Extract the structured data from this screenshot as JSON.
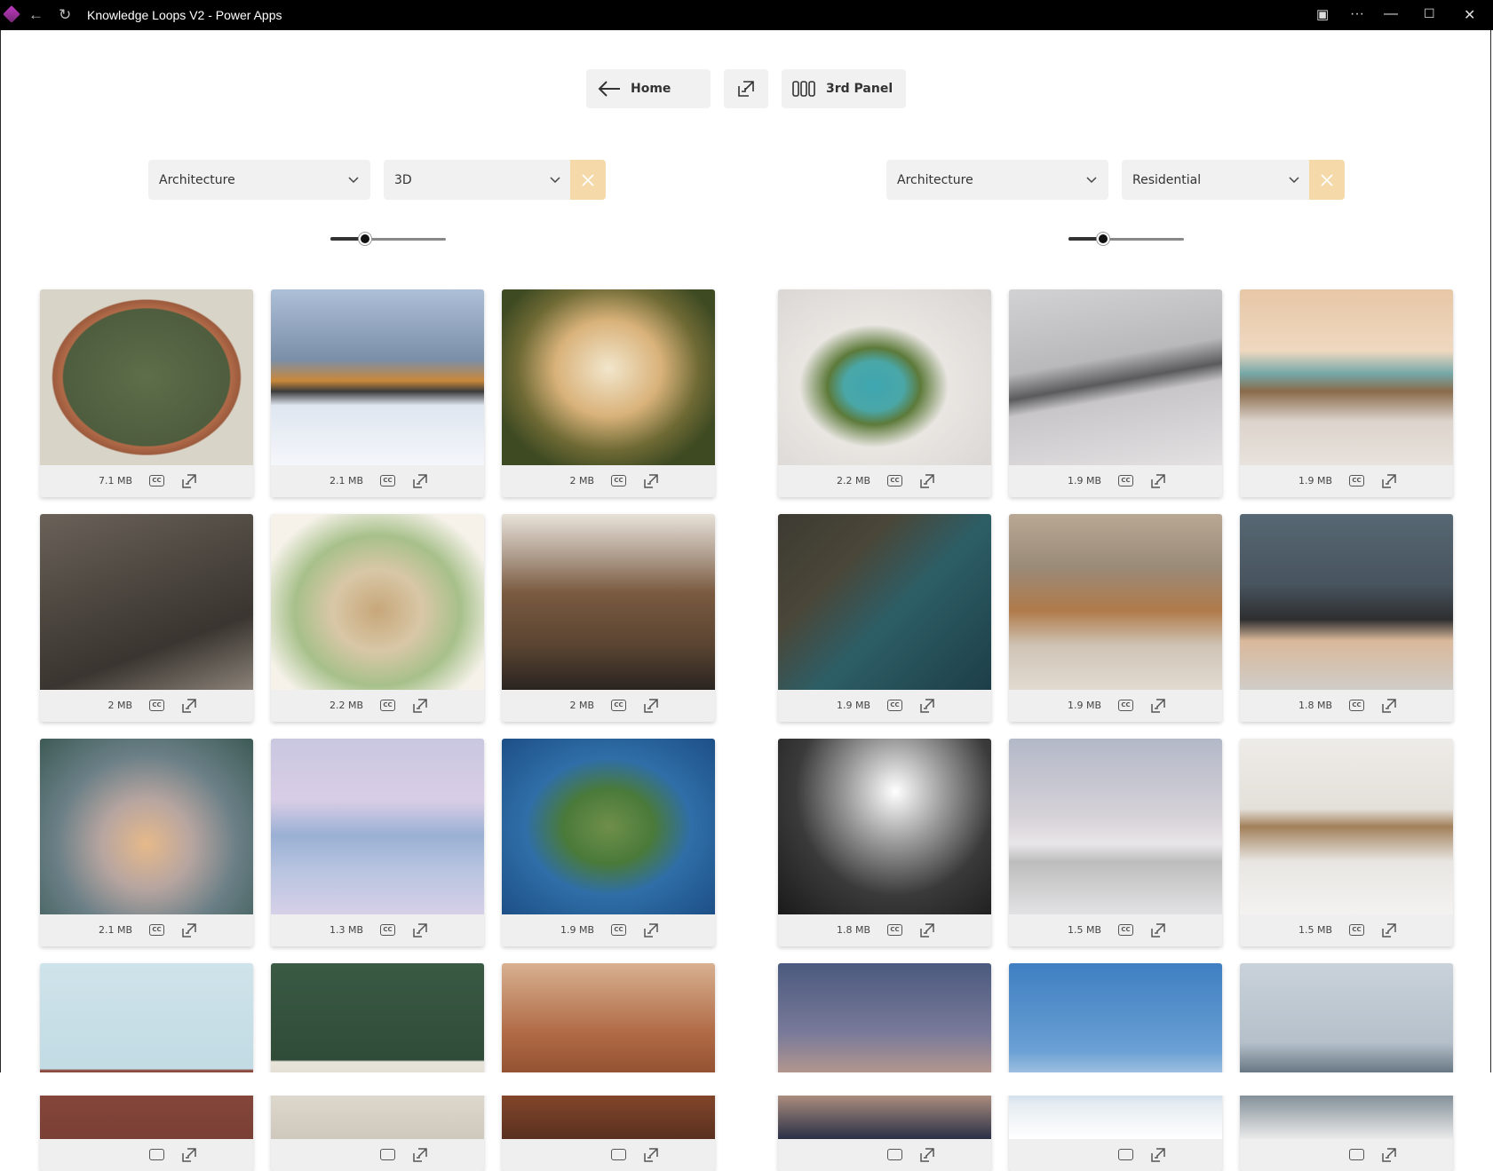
{
  "window": {
    "title": "Knowledge Loops V2 - Power Apps"
  },
  "toolbar": {
    "home_label": "Home",
    "third_panel_label": "3rd Panel"
  },
  "left_panel": {
    "category": "Architecture",
    "subcategory": "3D",
    "slider_value": 0.3,
    "cards": [
      {
        "size": "7.1 MB",
        "cc": "CC",
        "scene": "floorplan"
      },
      {
        "size": "2.1 MB",
        "cc": "CC",
        "scene": "snow-cabin"
      },
      {
        "size": "2 MB",
        "cc": "CC",
        "scene": "sky-tower"
      },
      {
        "size": "2 MB",
        "cc": "CC",
        "scene": "brutalist"
      },
      {
        "size": "2.2 MB",
        "cc": "CC",
        "scene": "japanese-house"
      },
      {
        "size": "2 MB",
        "cc": "CC",
        "scene": "library-section"
      },
      {
        "size": "2.1 MB",
        "cc": "CC",
        "scene": "alien-tower"
      },
      {
        "size": "1.3 MB",
        "cc": "CC",
        "scene": "lake-pavilion"
      },
      {
        "size": "1.9 MB",
        "cc": "CC",
        "scene": "eco-island"
      },
      {
        "size": "",
        "cc": "",
        "scene": "iso-building"
      },
      {
        "size": "",
        "cc": "",
        "scene": "iso-house"
      },
      {
        "size": "",
        "cc": "",
        "scene": "canyon-roof"
      }
    ]
  },
  "right_panel": {
    "category": "Architecture",
    "subcategory": "Residential",
    "slider_value": 0.3,
    "cards": [
      {
        "size": "2.2 MB",
        "cc": "CC",
        "scene": "dune-pool"
      },
      {
        "size": "1.9 MB",
        "cc": "CC",
        "scene": "dune-villa"
      },
      {
        "size": "1.9 MB",
        "cc": "CC",
        "scene": "beach-sunset"
      },
      {
        "size": "1.9 MB",
        "cc": "CC",
        "scene": "cliff-house"
      },
      {
        "size": "1.9 MB",
        "cc": "CC",
        "scene": "dune-curve"
      },
      {
        "size": "1.8 MB",
        "cc": "CC",
        "scene": "concrete-box"
      },
      {
        "size": "1.8 MB",
        "cc": "CC",
        "scene": "storm-glass"
      },
      {
        "size": "1.5 MB",
        "cc": "CC",
        "scene": "white-flat"
      },
      {
        "size": "1.5 MB",
        "cc": "CC",
        "scene": "beach-deck"
      },
      {
        "size": "",
        "cc": "",
        "scene": "dusk-sea"
      },
      {
        "size": "",
        "cc": "",
        "scene": "white-curves"
      },
      {
        "size": "",
        "cc": "",
        "scene": "glass-box"
      }
    ]
  }
}
